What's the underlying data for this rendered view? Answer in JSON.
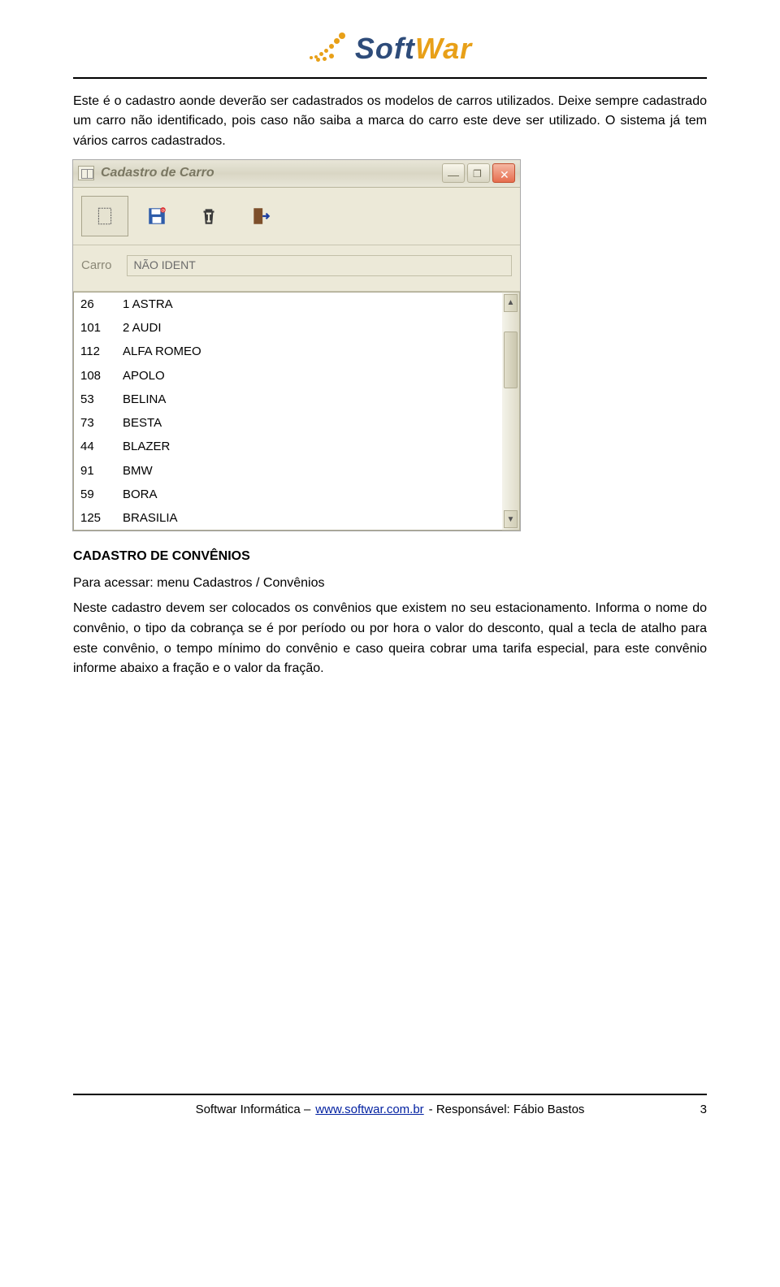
{
  "logo": {
    "left": "Soft",
    "right": "War"
  },
  "para1": "Este é o cadastro aonde deverão ser cadastrados os modelos de carros utilizados. Deixe sempre cadastrado um carro não identificado, pois caso não saiba a marca do carro este deve ser utilizado. O sistema já tem vários carros cadastrados.",
  "win": {
    "title": "Cadastro de Carro",
    "field_label": "Carro",
    "field_value": "NÃO IDENT",
    "list": [
      {
        "id": "26",
        "name": "1 ASTRA"
      },
      {
        "id": "101",
        "name": "2 AUDI"
      },
      {
        "id": "112",
        "name": "ALFA ROMEO"
      },
      {
        "id": "108",
        "name": "APOLO"
      },
      {
        "id": "53",
        "name": "BELINA"
      },
      {
        "id": "73",
        "name": "BESTA"
      },
      {
        "id": "44",
        "name": "BLAZER"
      },
      {
        "id": "91",
        "name": "BMW"
      },
      {
        "id": "59",
        "name": "BORA"
      },
      {
        "id": "125",
        "name": "BRASILIA"
      }
    ]
  },
  "section_heading": "CADASTRO DE CONVÊNIOS",
  "section_p1": "Para acessar: menu Cadastros / Convênios",
  "section_p2": "Neste cadastro devem ser colocados os convênios que existem no seu estacionamento. Informa o nome do convênio, o tipo da cobrança se é por período ou por hora o valor do desconto, qual a tecla de atalho para este convênio, o tempo mínimo do convênio e caso queira cobrar uma tarifa especial, para este convênio informe abaixo a fração e o valor da fração.",
  "footer": {
    "company": "Softwar Informática –",
    "url": "www.softwar.com.br",
    "rest": "- Responsável: Fábio Bastos",
    "page": "3"
  }
}
